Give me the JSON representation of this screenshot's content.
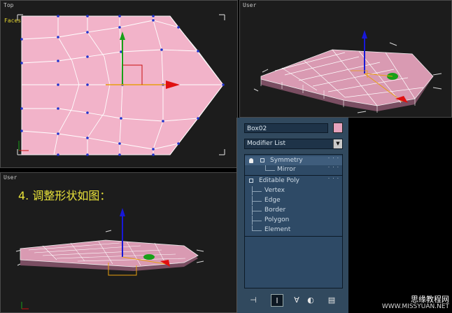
{
  "viewports": {
    "top": {
      "label": "Top",
      "faces": "Faces: 60"
    },
    "user_right": {
      "label": "User"
    },
    "user_bottom": {
      "label": "User"
    }
  },
  "caption": "4. 调整形状如图：",
  "panel": {
    "object_name": "Box02",
    "object_color": "#e7a3bd",
    "modifier_list": "Modifier List",
    "stack": [
      {
        "label": "Symmetry",
        "selected": true
      },
      {
        "label": "Mirror"
      },
      {
        "label": "Editable Poly"
      },
      {
        "label": "Vertex"
      },
      {
        "label": "Edge"
      },
      {
        "label": "Border"
      },
      {
        "label": "Polygon"
      },
      {
        "label": "Element"
      }
    ],
    "toolbar_icons": [
      "pin-stack-icon",
      "show-end-result-icon",
      "make-unique-icon",
      "remove-modifier-icon",
      "configure-modifier-sets-icon"
    ]
  },
  "watermark": {
    "line1": "思缘教程网",
    "line2": "WWW.MISSYUAN.NET"
  },
  "colors": {
    "mesh": "#f2b3c9",
    "accent_yellow": "#e8e23a",
    "gizmo_red": "#e01010",
    "gizmo_green": "#18a018",
    "gizmo_blue": "#1818d8"
  }
}
